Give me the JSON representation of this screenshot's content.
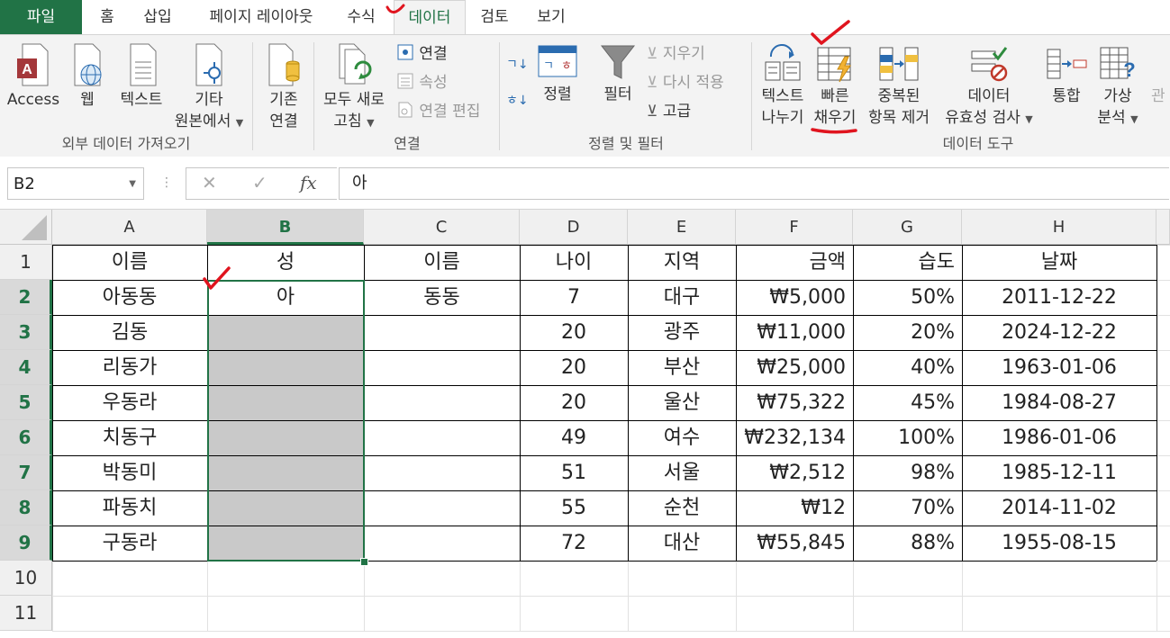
{
  "tabs": [
    "파일",
    "홈",
    "삽입",
    "페이지 레이아웃",
    "수식",
    "데이터",
    "검토",
    "보기"
  ],
  "ribbon": {
    "external_group": {
      "label": "외부 데이터 가져오기",
      "access": "Access",
      "web": "웹",
      "text": "텍스트",
      "other_l1": "기타",
      "other_l2": "원본에서"
    },
    "existing_l1": "기존",
    "existing_l2": "연결",
    "connections_group": {
      "label": "연결",
      "refresh_l1": "모두 새로",
      "refresh_l2": "고침",
      "connections": "연결",
      "properties": "속성",
      "edit_links": "연결 편집"
    },
    "sort_group": {
      "label": "정렬 및 필터",
      "sort": "정렬",
      "filter": "필터",
      "clear": "지우기",
      "reapply": "다시 적용",
      "advanced": "고급",
      "az": "↓",
      "za": "↓"
    },
    "tools_group": {
      "label": "데이터 도구",
      "text_to_columns_l1": "텍스트",
      "text_to_columns_l2": "나누기",
      "flash_fill_l1": "빠른",
      "flash_fill_l2": "채우기",
      "remove_dup_l1": "중복된",
      "remove_dup_l2": "항목 제거",
      "validation_l1": "데이터",
      "validation_l2": "유효성 검사",
      "consolidate": "통합",
      "whatif_l1": "가상",
      "whatif_l2": "분석",
      "relations": "관"
    }
  },
  "formula_bar": {
    "name_box": "B2",
    "formula": "아",
    "fx": "fx",
    "cancel": "✕",
    "enter": "✓"
  },
  "columns": [
    "A",
    "B",
    "C",
    "D",
    "E",
    "F",
    "G",
    "H"
  ],
  "rows": [
    "1",
    "2",
    "3",
    "4",
    "5",
    "6",
    "7",
    "8",
    "9",
    "10",
    "11"
  ],
  "table": {
    "headers": [
      "이름",
      "성",
      "이름",
      "나이",
      "지역",
      "금액",
      "습도",
      "날짜"
    ],
    "data": [
      [
        "아동동",
        "아",
        "동동",
        "7",
        "대구",
        "₩5,000",
        "50%",
        "2011-12-22"
      ],
      [
        "김동",
        "",
        "",
        "20",
        "광주",
        "₩11,000",
        "20%",
        "2024-12-22"
      ],
      [
        "리동가",
        "",
        "",
        "20",
        "부산",
        "₩25,000",
        "40%",
        "1963-01-06"
      ],
      [
        "우동라",
        "",
        "",
        "20",
        "울산",
        "₩75,322",
        "45%",
        "1984-08-27"
      ],
      [
        "치동구",
        "",
        "",
        "49",
        "여수",
        "₩232,134",
        "100%",
        "1986-01-06"
      ],
      [
        "박동미",
        "",
        "",
        "51",
        "서울",
        "₩2,512",
        "98%",
        "1985-12-11"
      ],
      [
        "파동치",
        "",
        "",
        "55",
        "순천",
        "₩12",
        "70%",
        "2014-11-02"
      ],
      [
        "구동라",
        "",
        "",
        "72",
        "대산",
        "₩55,845",
        "88%",
        "1955-08-15"
      ]
    ]
  },
  "colors": {
    "excel_green": "#217346",
    "annotation_red": "#e0141e",
    "fill_grey": "#c9c9c9"
  }
}
